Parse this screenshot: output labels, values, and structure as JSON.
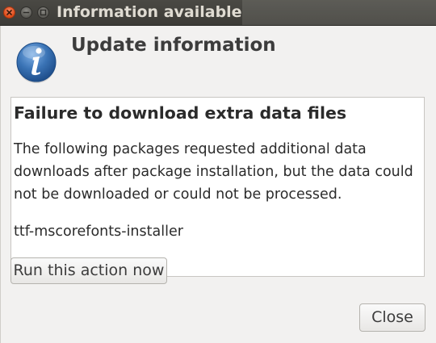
{
  "window": {
    "title": "Information available"
  },
  "dialog": {
    "heading": "Update information",
    "icon": "info-icon",
    "message_title": "Failure to download extra data files",
    "message_body": "The following packages requested additional data downloads after package installation, but the data could not be downloaded or could not be processed.",
    "package_name": "ttf-mscorefonts-installer",
    "run_action_label": "Run this action now",
    "close_label": "Close"
  },
  "colors": {
    "titlebar": "#3c3b37",
    "close_button": "#df4a16",
    "dialog_bg": "#f2f1f0",
    "icon_blue": "#3a73b5"
  }
}
